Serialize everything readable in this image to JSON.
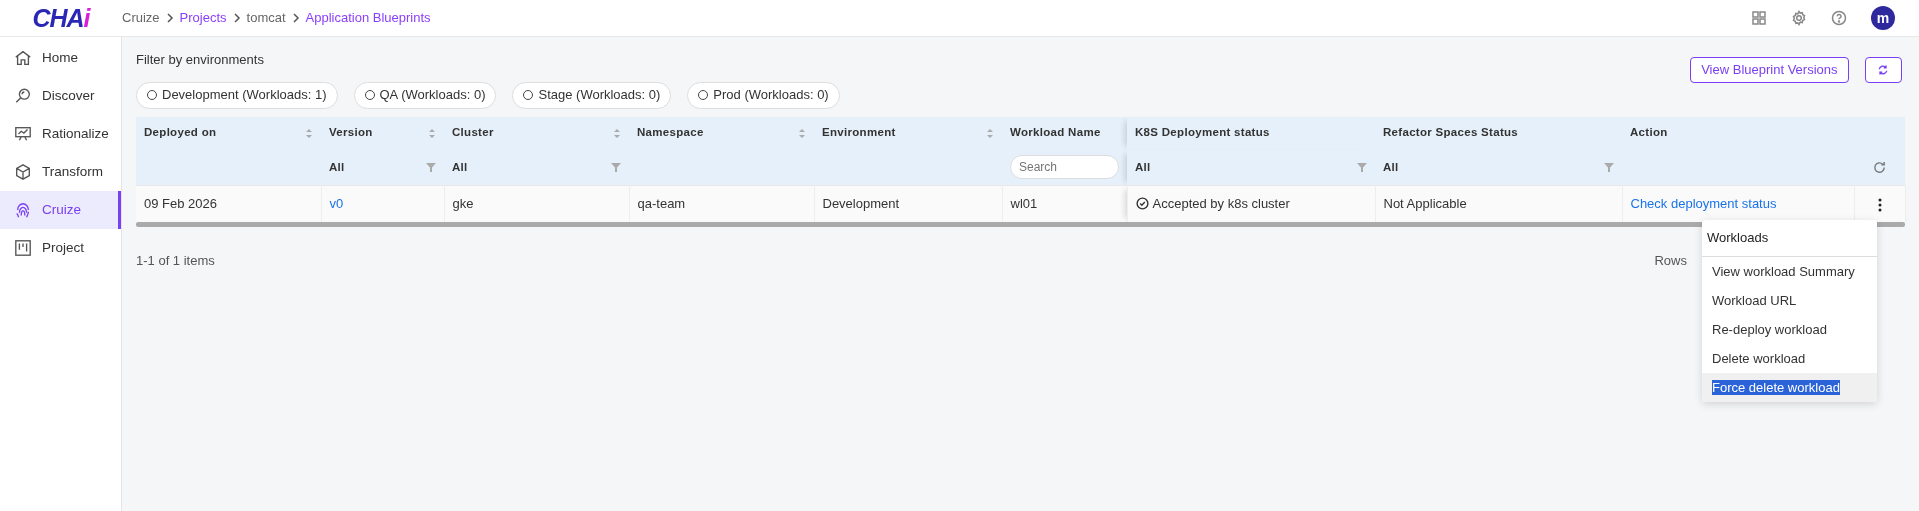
{
  "logo": {
    "main": "CHA",
    "accent": "i"
  },
  "breadcrumb": [
    {
      "label": "Cruize",
      "link": false
    },
    {
      "label": "Projects",
      "link": true
    },
    {
      "label": "tomcat",
      "link": false
    },
    {
      "label": "Application Blueprints",
      "link": true
    }
  ],
  "user": {
    "initial": "m"
  },
  "sidebar": {
    "items": [
      {
        "label": "Home",
        "selected": false
      },
      {
        "label": "Discover",
        "selected": false
      },
      {
        "label": "Rationalize",
        "selected": false
      },
      {
        "label": "Transform",
        "selected": false
      },
      {
        "label": "Cruize",
        "selected": true
      },
      {
        "label": "Project",
        "selected": false
      }
    ]
  },
  "filter": {
    "title": "Filter by environments",
    "chips": [
      {
        "label": "Development (Workloads: 1)",
        "selected": false
      },
      {
        "label": "QA (Workloads: 0)",
        "selected": false
      },
      {
        "label": "Stage (Workloads: 0)",
        "selected": false
      },
      {
        "label": "Prod (Workloads: 0)",
        "selected": false
      }
    ]
  },
  "actions": {
    "versions_button": "View Blueprint Versions"
  },
  "table": {
    "columns": [
      {
        "label": "Deployed on",
        "sortable": true
      },
      {
        "label": "Version",
        "sortable": true,
        "filter": {
          "kind": "select",
          "value": "All"
        }
      },
      {
        "label": "Cluster",
        "sortable": true,
        "filter": {
          "kind": "select",
          "value": "All"
        }
      },
      {
        "label": "Namespace",
        "sortable": true
      },
      {
        "label": "Environment",
        "sortable": true
      },
      {
        "label": "Workload Name",
        "sortable": false,
        "filter": {
          "kind": "search",
          "placeholder": "Search"
        }
      },
      {
        "label": "K8S Deployment status",
        "sortable": false,
        "filter": {
          "kind": "select",
          "value": "All"
        }
      },
      {
        "label": "Refactor Spaces Status",
        "sortable": false,
        "filter": {
          "kind": "select",
          "value": "All"
        }
      },
      {
        "label": "Action",
        "sortable": false
      }
    ],
    "rows": [
      {
        "cells": [
          {
            "kind": "text",
            "text": "09 Feb 2026"
          },
          {
            "kind": "link",
            "text": "v0"
          },
          {
            "kind": "text",
            "text": "gke"
          },
          {
            "kind": "text",
            "text": "qa-team"
          },
          {
            "kind": "text",
            "text": "Development"
          },
          {
            "kind": "text",
            "text": "wl01"
          },
          {
            "kind": "status",
            "text": "Accepted by k8s cluster"
          },
          {
            "kind": "text",
            "text": "Not Applicable"
          },
          {
            "kind": "link",
            "text": "Check deployment status"
          }
        ]
      }
    ]
  },
  "pagination": {
    "summary": "1-1 of 1 items",
    "rows_label": "Rows"
  },
  "menu": {
    "title": "Workloads",
    "items": [
      {
        "label": "View workload Summary",
        "selected": false
      },
      {
        "label": "Workload URL",
        "selected": false
      },
      {
        "label": "Re-deploy workload",
        "selected": false
      },
      {
        "label": "Delete workload",
        "selected": false
      },
      {
        "label": "Force delete workload",
        "selected": true
      }
    ]
  }
}
